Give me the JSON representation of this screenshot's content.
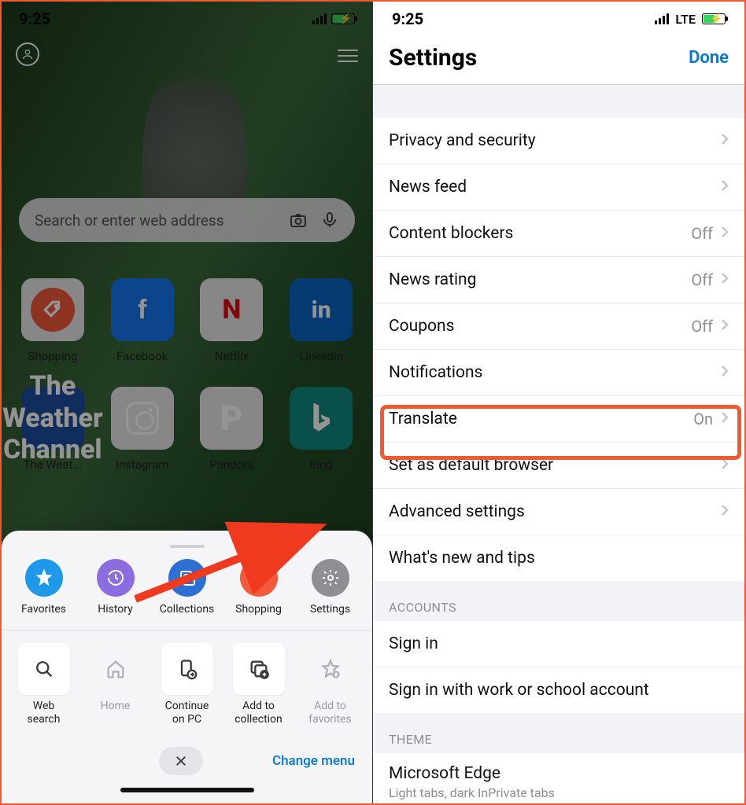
{
  "left": {
    "time": "9:25",
    "search_placeholder": "Search or enter web address",
    "tiles": [
      {
        "label": "Shopping"
      },
      {
        "label": "Facebook"
      },
      {
        "label": "Netflix"
      },
      {
        "label": "Linkedin"
      },
      {
        "label": "The Weat..."
      },
      {
        "label": "Instagram"
      },
      {
        "label": "Pandora"
      },
      {
        "label": "Bing"
      }
    ],
    "sheet_top": [
      {
        "label": "Favorites",
        "color": "#1e98e8"
      },
      {
        "label": "History",
        "color": "#8b6de0"
      },
      {
        "label": "Collections",
        "color": "#2d6fd2"
      },
      {
        "label": "Shopping",
        "color": "#f15a3a"
      },
      {
        "label": "Settings",
        "color": "#8e8e93"
      }
    ],
    "sheet_actions": [
      {
        "label": "Web\nsearch"
      },
      {
        "label": "Home",
        "dim": true
      },
      {
        "label": "Continue\non PC"
      },
      {
        "label": "Add to\ncollection"
      },
      {
        "label": "Add to\nfavorites",
        "dim": true
      }
    ],
    "change_menu": "Change menu"
  },
  "right": {
    "time": "9:25",
    "network": "LTE",
    "title": "Settings",
    "done": "Done",
    "rows1": [
      {
        "label": "Privacy and security",
        "value": ""
      },
      {
        "label": "News feed",
        "value": ""
      },
      {
        "label": "Content blockers",
        "value": "Off"
      },
      {
        "label": "News rating",
        "value": "Off"
      },
      {
        "label": "Coupons",
        "value": "Off"
      },
      {
        "label": "Notifications",
        "value": ""
      },
      {
        "label": "Translate",
        "value": "On"
      },
      {
        "label": "Set as default browser",
        "value": ""
      },
      {
        "label": "Advanced settings",
        "value": ""
      },
      {
        "label": "What's new and tips",
        "value": "",
        "no_chevron": true
      }
    ],
    "accounts_header": "ACCOUNTS",
    "accounts": [
      {
        "label": "Sign in"
      },
      {
        "label": "Sign in with work or school account"
      }
    ],
    "theme_header": "THEME",
    "theme_row": {
      "label": "Microsoft Edge",
      "sub": "Light tabs, dark InPrivate tabs"
    }
  }
}
